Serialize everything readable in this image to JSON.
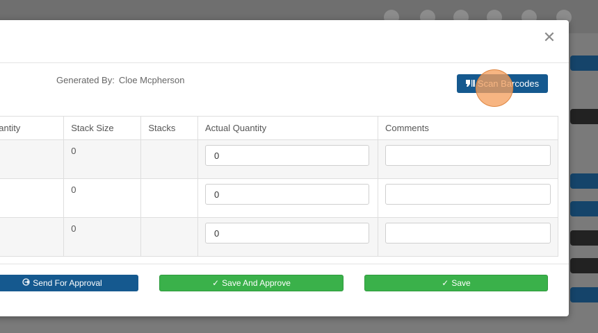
{
  "colors": {
    "primary": "#15598f",
    "success": "#3ab14a",
    "overlay": "#7a7a7a"
  },
  "modal": {
    "close_icon": "close-icon",
    "generated_by_label": "Generated By:",
    "generated_by_value": "Cloe Mcpherson",
    "scan_button_label": "Scan Barcodes",
    "scan_button_icon": "barcode-icon"
  },
  "table": {
    "headers": [
      "uantity",
      "Stack Size",
      "Stacks",
      "Actual Quantity",
      "Comments"
    ],
    "rows": [
      {
        "stack_size": "0",
        "stacks": "",
        "actual_quantity": "0",
        "comments": ""
      },
      {
        "stack_size": "0",
        "stacks": "",
        "actual_quantity": "0",
        "comments": ""
      },
      {
        "stack_size": "0",
        "stacks": "",
        "actual_quantity": "0",
        "comments": ""
      }
    ]
  },
  "footer": {
    "send_label": "Send For Approval",
    "send_icon": "sign-out-icon",
    "save_approve_label": "Save And Approve",
    "save_label": "Save",
    "check_icon": "check-icon"
  }
}
